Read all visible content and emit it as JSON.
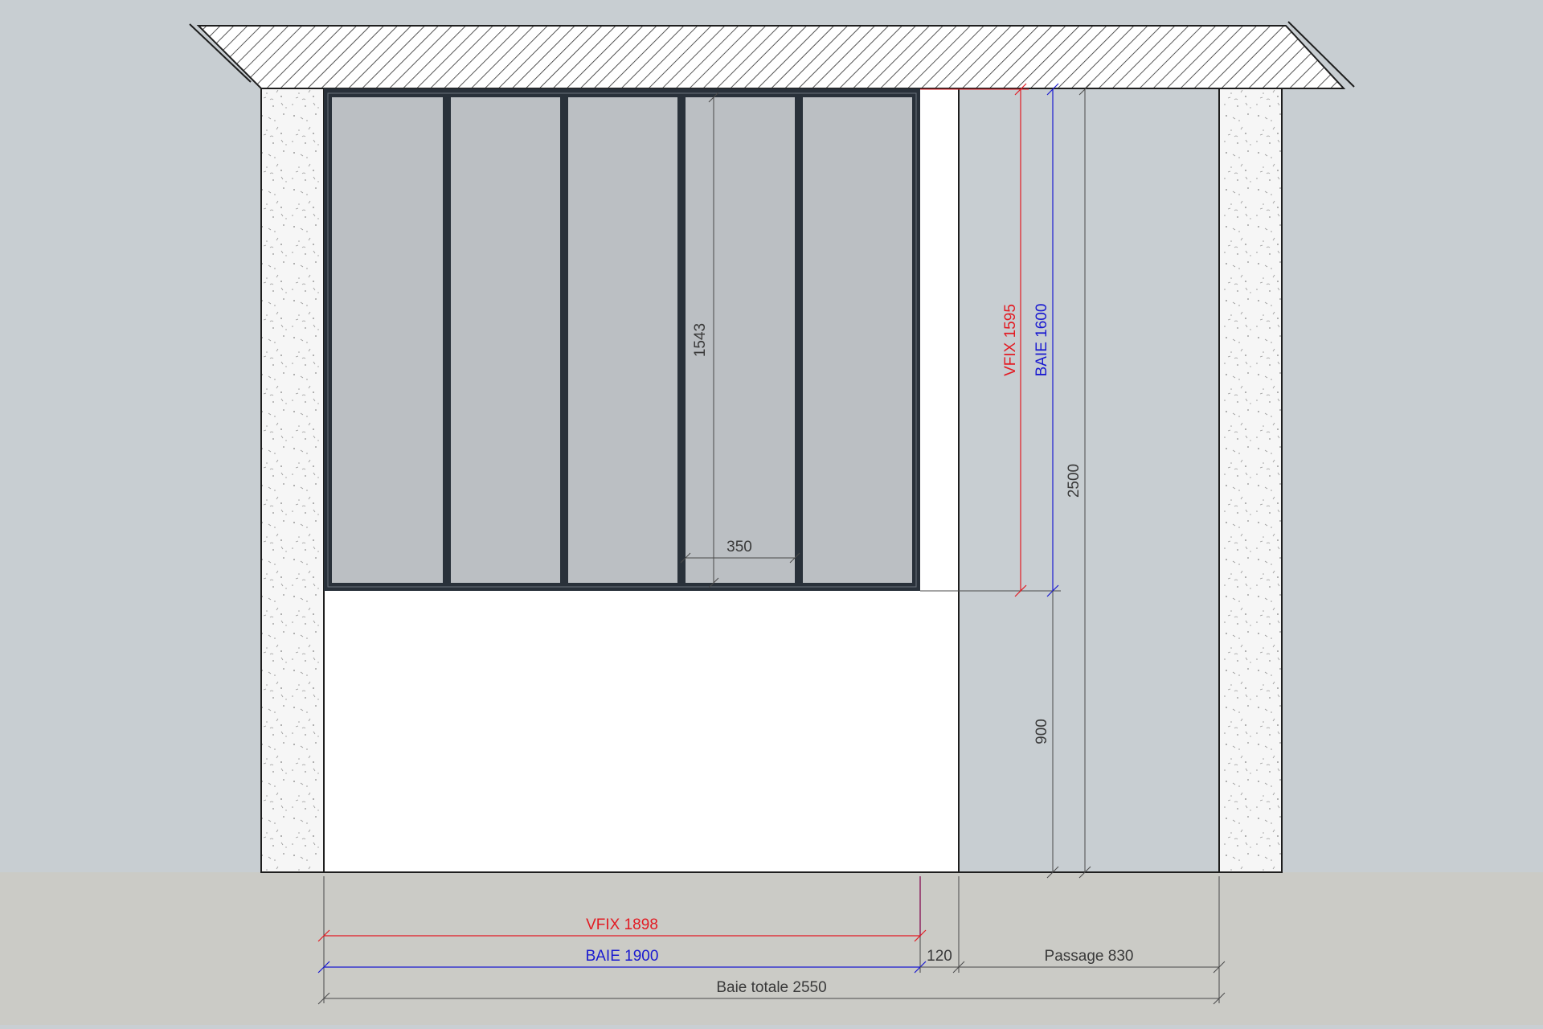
{
  "colors": {
    "wall_background": "#c8ced2",
    "floor": "#cbcbc6",
    "partition_wall": "#ffffff",
    "glass": "#bbbfc3",
    "frame": "#29313a",
    "dim_red": "#e21b23",
    "dim_blue": "#1a1ad0",
    "dim_dark": "#4a4a4a"
  },
  "dimensions": {
    "mullion_height": "1543",
    "pane_width": "350",
    "vfix_height": "VFIX 1595",
    "baie_height": "BAIE 1600",
    "total_height": "2500",
    "lower_height": "900",
    "vfix_width": "VFIX 1898",
    "baie_width": "BAIE 1900",
    "gap_width": "120",
    "passage_width": "Passage 830",
    "total_width": "Baie totale 2550"
  }
}
